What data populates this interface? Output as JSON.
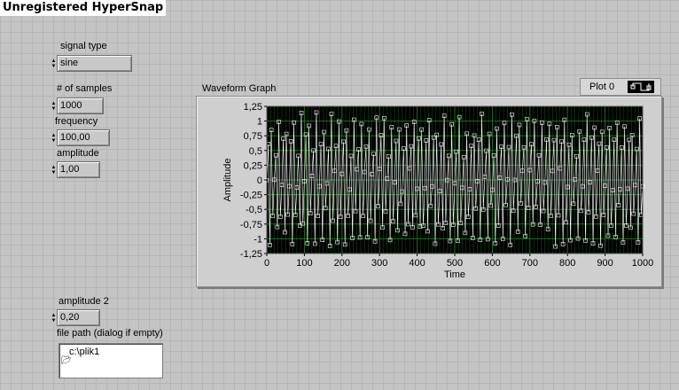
{
  "watermark": "Unregistered HyperSnap",
  "controls": {
    "signal_type": {
      "label": "signal type",
      "value": "sine"
    },
    "num_samples": {
      "label": "# of samples",
      "value": "1000"
    },
    "frequency": {
      "label": "frequency",
      "value": "100,00"
    },
    "amplitude": {
      "label": "amplitude",
      "value": "1,00"
    },
    "amplitude2": {
      "label": "amplitude 2",
      "value": "0,20"
    },
    "file_path": {
      "label": "file path (dialog if empty)",
      "value": "c:\\plik1"
    }
  },
  "graph": {
    "label": "Waveform Graph",
    "legend_label": "Plot 0"
  },
  "chart_data": {
    "type": "line",
    "title": "Waveform Graph",
    "xlabel": "Time",
    "ylabel": "Amplitude",
    "xlim": [
      0,
      1000
    ],
    "ylim": [
      -1.25,
      1.25
    ],
    "x_ticks": [
      "0",
      "100",
      "200",
      "300",
      "400",
      "500",
      "600",
      "700",
      "800",
      "900",
      "1000"
    ],
    "y_ticks": [
      "1,25",
      "1",
      "0,75",
      "0,5",
      "0,25",
      "0",
      "-0,25",
      "-0,5",
      "-0,75",
      "-1",
      "-1,25"
    ],
    "grid": true,
    "series": [
      {
        "name": "Plot 0",
        "signal": "sine",
        "samples": 1000,
        "frequency": 100,
        "amplitude": 1.0,
        "noise_amplitude": 0.2
      }
    ],
    "colors": {
      "background": "#000000",
      "grid": "#1f6b1f",
      "trace": "#ffffff"
    }
  }
}
